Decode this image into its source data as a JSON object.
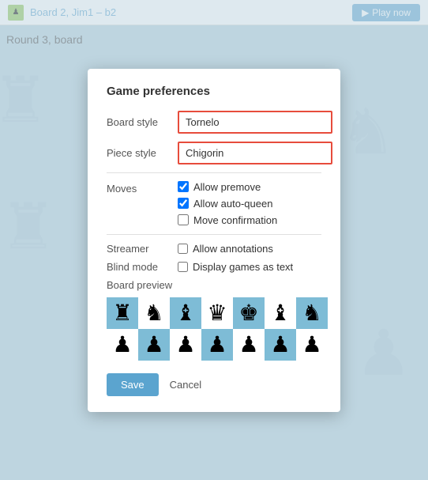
{
  "topBar": {
    "title": "Board 2, Jim1 – b2",
    "playNowLabel": "Play now"
  },
  "roundLabel": "Round 3, board",
  "modal": {
    "title": "Game preferences",
    "boardStyleLabel": "Board style",
    "boardStyleValue": "Tornelo",
    "pieceStyleLabel": "Piece style",
    "pieceStyleValue": "Chigorin",
    "movesLabel": "Moves",
    "allowPremoveLabel": "Allow premove",
    "allowPremoveChecked": true,
    "allowAutoQueenLabel": "Allow auto-queen",
    "allowAutoQueenChecked": true,
    "moveConfirmationLabel": "Move confirmation",
    "moveConfirmationChecked": false,
    "streamerLabel": "Streamer",
    "allowAnnotationsLabel": "Allow annotations",
    "allowAnnotationsChecked": false,
    "blindModeLabel": "Blind mode",
    "displayAsTextLabel": "Display games as text",
    "displayAsTextChecked": false,
    "boardPreviewTitle": "Board preview",
    "saveLabel": "Save",
    "cancelLabel": "Cancel"
  },
  "boardCells": [
    {
      "shade": "dark",
      "piece": "♜"
    },
    {
      "shade": "light",
      "piece": "♞"
    },
    {
      "shade": "dark",
      "piece": "♝"
    },
    {
      "shade": "light",
      "piece": "♛"
    },
    {
      "shade": "dark",
      "piece": "♚"
    },
    {
      "shade": "light",
      "piece": "♝"
    },
    {
      "shade": "dark",
      "piece": "♞"
    },
    {
      "shade": "light",
      "piece": "♟"
    },
    {
      "shade": "dark",
      "piece": "♟"
    },
    {
      "shade": "light",
      "piece": "♟"
    },
    {
      "shade": "dark",
      "piece": "♟"
    },
    {
      "shade": "light",
      "piece": "♟"
    },
    {
      "shade": "dark",
      "piece": "♟"
    },
    {
      "shade": "light",
      "piece": "♟"
    }
  ]
}
